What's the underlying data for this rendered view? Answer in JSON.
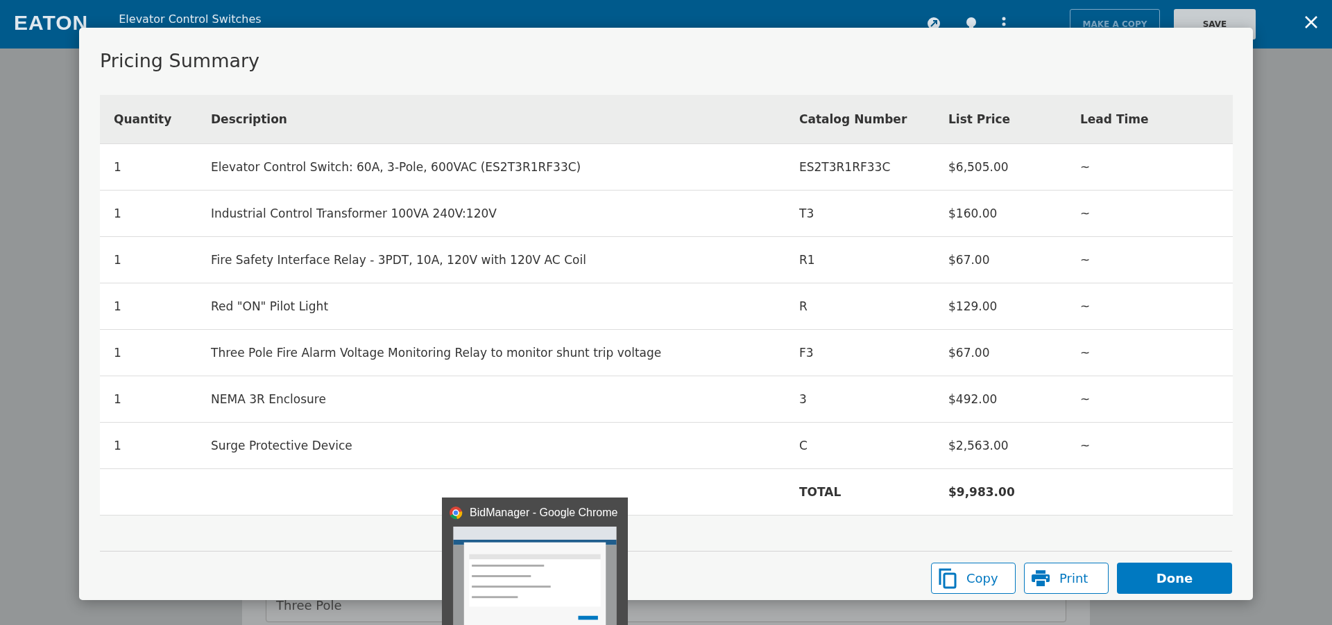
{
  "header": {
    "logo": "EATON",
    "title": "Elevator Control Switches",
    "buttons": [
      {
        "label": "MAKE A COPY",
        "kind": "outline"
      },
      {
        "label": "SAVE",
        "kind": "filled"
      }
    ]
  },
  "background_form": {
    "field_value": "Three Pole"
  },
  "dialog": {
    "title": "Pricing Summary",
    "table": {
      "columns": [
        "Quantity",
        "Description",
        "Catalog Number",
        "List Price",
        "Lead Time"
      ],
      "rows": [
        {
          "quantity": "1",
          "description": "Elevator Control Switch: 60A, 3-Pole, 600VAC (ES2T3R1RF33C)",
          "catalog_number": "ES2T3R1RF33C",
          "list_price": "$6,505.00",
          "lead_time": "~"
        },
        {
          "quantity": "1",
          "description": "Industrial Control Transformer 100VA 240V:120V",
          "catalog_number": "T3",
          "list_price": "$160.00",
          "lead_time": "~"
        },
        {
          "quantity": "1",
          "description": "Fire Safety Interface Relay - 3PDT, 10A, 120V with 120V AC Coil",
          "catalog_number": "R1",
          "list_price": "$67.00",
          "lead_time": "~"
        },
        {
          "quantity": "1",
          "description": "Red \"ON\" Pilot Light",
          "catalog_number": "R",
          "list_price": "$129.00",
          "lead_time": "~"
        },
        {
          "quantity": "1",
          "description": "Three Pole Fire Alarm Voltage Monitoring Relay to monitor shunt trip voltage",
          "catalog_number": "F3",
          "list_price": "$67.00",
          "lead_time": "~"
        },
        {
          "quantity": "1",
          "description": "NEMA 3R Enclosure",
          "catalog_number": "3",
          "list_price": "$492.00",
          "lead_time": "~"
        },
        {
          "quantity": "1",
          "description": "Surge Protective Device",
          "catalog_number": "C",
          "list_price": "$2,563.00",
          "lead_time": "~"
        }
      ],
      "total": {
        "label": "TOTAL",
        "value": "$9,983.00"
      }
    },
    "buttons": [
      {
        "label": "Copy",
        "kind": "copy"
      },
      {
        "label": "Print",
        "kind": "print"
      },
      {
        "label": "Done",
        "kind": "primary"
      }
    ]
  },
  "taskbar_preview": {
    "title": "BidManager - Google Chrome"
  }
}
